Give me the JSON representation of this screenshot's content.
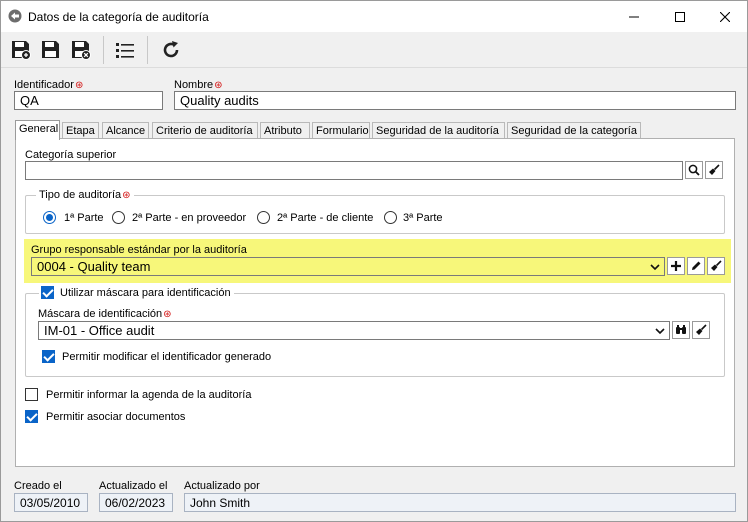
{
  "window": {
    "title": "Datos de la categoría de auditoría"
  },
  "header": {
    "identifier_label": "Identificador",
    "identifier_value": "QA",
    "name_label": "Nombre",
    "name_value": "Quality audits"
  },
  "tabs": [
    {
      "label": "General"
    },
    {
      "label": "Etapa"
    },
    {
      "label": "Alcance"
    },
    {
      "label": "Criterio de auditoría"
    },
    {
      "label": "Atributo"
    },
    {
      "label": "Formulario"
    },
    {
      "label": "Seguridad de la auditoría"
    },
    {
      "label": "Seguridad de la categoría"
    }
  ],
  "general": {
    "parent_category_label": "Categoría superior",
    "parent_category_value": "",
    "audit_type_label": "Tipo de auditoría",
    "audit_type_options": [
      {
        "label": "1ª Parte",
        "selected": true
      },
      {
        "label": "2ª Parte - en proveedor",
        "selected": false
      },
      {
        "label": "2ª Parte - de cliente",
        "selected": false
      },
      {
        "label": "3ª Parte",
        "selected": false
      }
    ],
    "responsible_group_label": "Grupo responsable estándar por la auditoría",
    "responsible_group_value": "0004 - Quality team",
    "use_mask_label": "Utilizar máscara para identificación",
    "use_mask_checked": true,
    "mask_label": "Máscara de identificación",
    "mask_value": "IM-01 - Office audit",
    "allow_modify_id_label": "Permitir modificar el identificador generado",
    "allow_modify_id_checked": true,
    "allow_schedule_label": "Permitir informar la agenda de la auditoría",
    "allow_schedule_checked": false,
    "allow_documents_label": "Permitir asociar documentos",
    "allow_documents_checked": true
  },
  "footer": {
    "created_label": "Creado el",
    "created_value": "03/05/2010",
    "updated_label": "Actualizado el",
    "updated_value": "06/02/2023",
    "updated_by_label": "Actualizado por",
    "updated_by_value": "John Smith"
  },
  "colors": {
    "highlight": "#f7f77a",
    "accent": "#0a64c8",
    "required": "#d21010"
  }
}
